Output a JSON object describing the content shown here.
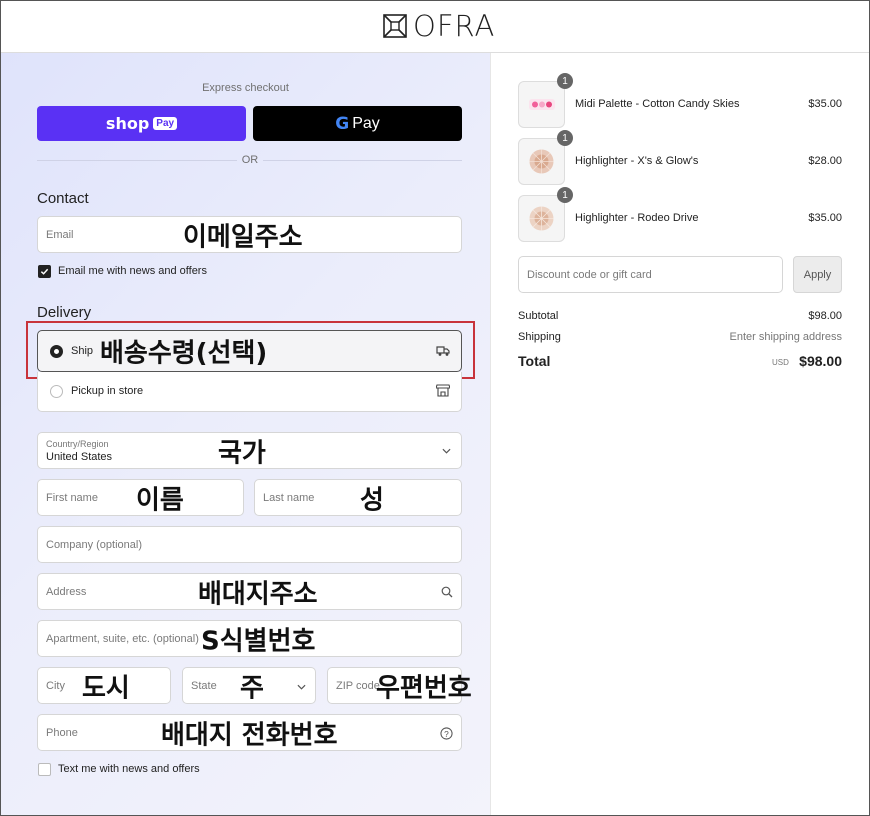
{
  "brand": {
    "name": "OFRA"
  },
  "express": {
    "title": "Express checkout",
    "shop_label": "shop",
    "shop_pay_tag": "Pay",
    "gpay_label": "Pay",
    "or_label": "OR"
  },
  "contact": {
    "heading": "Contact",
    "email_placeholder": "Email",
    "email_overlay": "이메일주소",
    "news_label": "Email me with news and offers"
  },
  "delivery": {
    "heading": "Delivery",
    "ship_label": "Ship",
    "ship_overlay": "배송수령(선택)",
    "pickup_label": "Pickup in store",
    "country_label": "Country/Region",
    "country_value": "United States",
    "country_overlay": "국가",
    "first_name_placeholder": "First name",
    "first_name_overlay": "이름",
    "last_name_placeholder": "Last name",
    "last_name_overlay": "성",
    "company_placeholder": "Company (optional)",
    "address_placeholder": "Address",
    "address_overlay": "배대지주소",
    "apartment_placeholder": "Apartment, suite, etc. (optional)",
    "apartment_overlay": "S식별번호",
    "city_placeholder": "City",
    "city_overlay": "도시",
    "state_placeholder": "State",
    "state_overlay": "주",
    "zip_placeholder": "ZIP code",
    "zip_overlay": "우편번호",
    "phone_placeholder": "Phone",
    "phone_overlay": "배대지 전화번호",
    "text_label": "Text me with news and offers"
  },
  "cart": {
    "items": [
      {
        "name": "Midi Palette - Cotton Candy Skies",
        "price": "$35.00",
        "qty": "1"
      },
      {
        "name": "Highlighter - X's & Glow's",
        "price": "$28.00",
        "qty": "1"
      },
      {
        "name": "Highlighter - Rodeo Drive",
        "price": "$35.00",
        "qty": "1"
      }
    ],
    "discount_placeholder": "Discount code or gift card",
    "apply_label": "Apply",
    "subtotal_label": "Subtotal",
    "subtotal_value": "$98.00",
    "shipping_label": "Shipping",
    "shipping_value": "Enter shipping address",
    "total_label": "Total",
    "currency": "USD",
    "total_value": "$98.00"
  },
  "colors": {
    "shop_pay": "#5a31f4",
    "gpay": "#000000",
    "highlight_border": "#c8333b",
    "checkbox": "#222222"
  }
}
